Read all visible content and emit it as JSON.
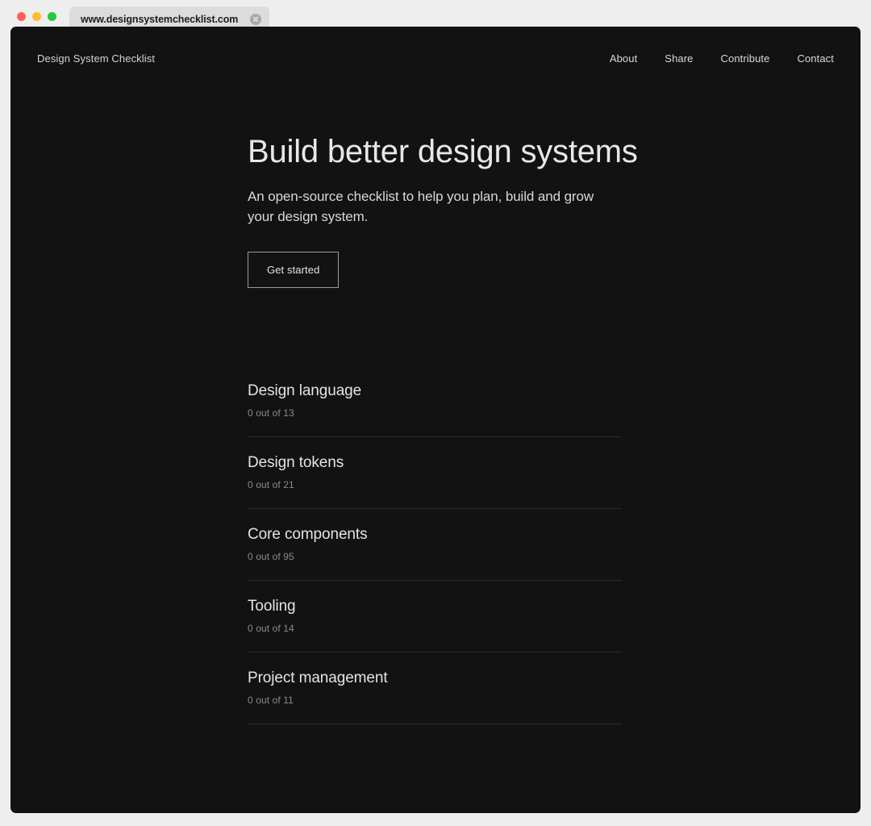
{
  "browser": {
    "url": "www.designsystemchecklist.com",
    "clear_icon": "close-circle-icon",
    "traffic_lights": [
      "close",
      "minimize",
      "maximize"
    ]
  },
  "site": {
    "brand": "Design System Checklist",
    "nav": [
      {
        "label": "About"
      },
      {
        "label": "Share"
      },
      {
        "label": "Contribute"
      },
      {
        "label": "Contact"
      }
    ]
  },
  "hero": {
    "title": "Build better design systems",
    "subtitle": "An open-source checklist to help you plan, build and grow your design system.",
    "cta_label": "Get started"
  },
  "checklist": [
    {
      "title": "Design language",
      "count": "0 out of 13"
    },
    {
      "title": "Design tokens",
      "count": "0 out of 21"
    },
    {
      "title": "Core components",
      "count": "0 out of 95"
    },
    {
      "title": "Tooling",
      "count": "0 out of 14"
    },
    {
      "title": "Project management",
      "count": "0 out of 11"
    }
  ],
  "colors": {
    "panel_bg": "#121212",
    "page_bg": "#eeeeee",
    "text_primary": "#e4e4e4",
    "text_muted": "#8b8b8b",
    "divider": "#2c2c2c",
    "traffic_close": "#ff5f57",
    "traffic_min": "#febc2e",
    "traffic_max": "#28c840"
  }
}
